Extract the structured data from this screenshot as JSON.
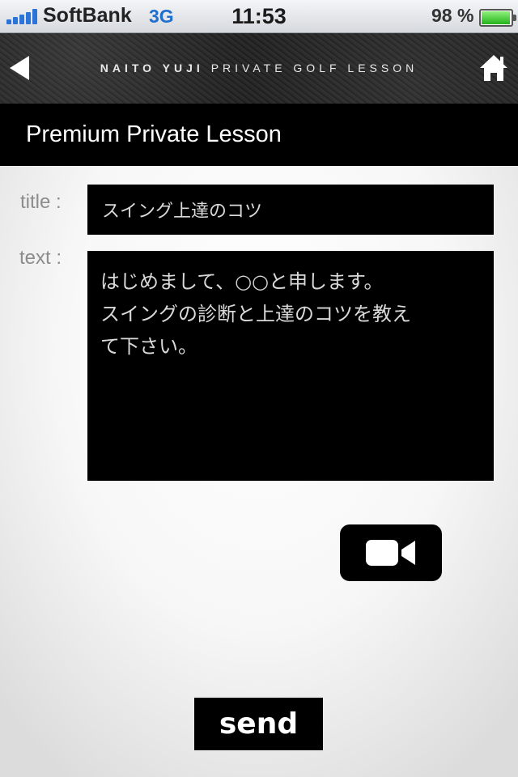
{
  "status_bar": {
    "carrier": "SoftBank",
    "network": "3G",
    "time": "11:53",
    "battery_percent": "98 %",
    "battery_level": 0.98
  },
  "header": {
    "title_strong": "NAITO YUJI",
    "title_rest": " PRIVATE GOLF LESSON",
    "back_icon": "back-arrow-icon",
    "home_icon": "home-icon"
  },
  "section": {
    "title": "Premium Private Lesson"
  },
  "form": {
    "title_label": "title :",
    "title_value": "スイング上達のコツ",
    "text_label": "text :",
    "text_value": "はじめまして、○○と申します。\nスイングの診断と上達のコツを教え\nて下さい。",
    "video_icon": "video-camera-icon",
    "send_label": "send"
  }
}
